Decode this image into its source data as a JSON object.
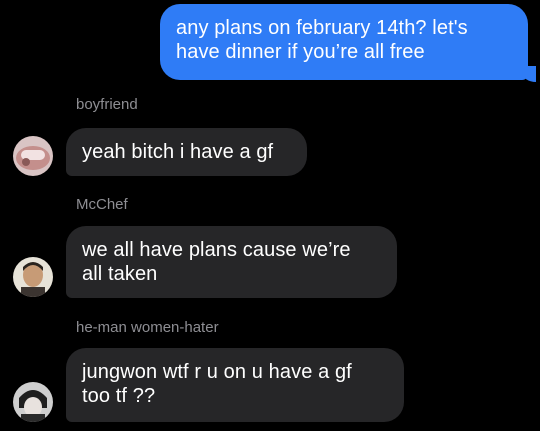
{
  "messages": [
    {
      "direction": "outgoing",
      "lines": [
        "any plans on february 14th? let's",
        "have dinner if you’re all free"
      ]
    },
    {
      "direction": "incoming",
      "sender": "boyfriend",
      "avatar_icon": "avatar-photo-icon",
      "lines": [
        "yeah bitch i have a gf"
      ]
    },
    {
      "direction": "incoming",
      "sender": "McChef",
      "avatar_icon": "avatar-photo-icon",
      "lines": [
        "we all have plans cause we’re",
        "all taken"
      ]
    },
    {
      "direction": "incoming",
      "sender": "he-man women-hater",
      "avatar_icon": "avatar-photo-icon",
      "lines": [
        "jungwon wtf r u on u have a gf",
        "too tf ??"
      ]
    }
  ],
  "colors": {
    "outgoing_bubble": "#2f7cf6",
    "incoming_bubble": "#262628",
    "sender_name": "#8e8e93",
    "background": "#000000"
  }
}
